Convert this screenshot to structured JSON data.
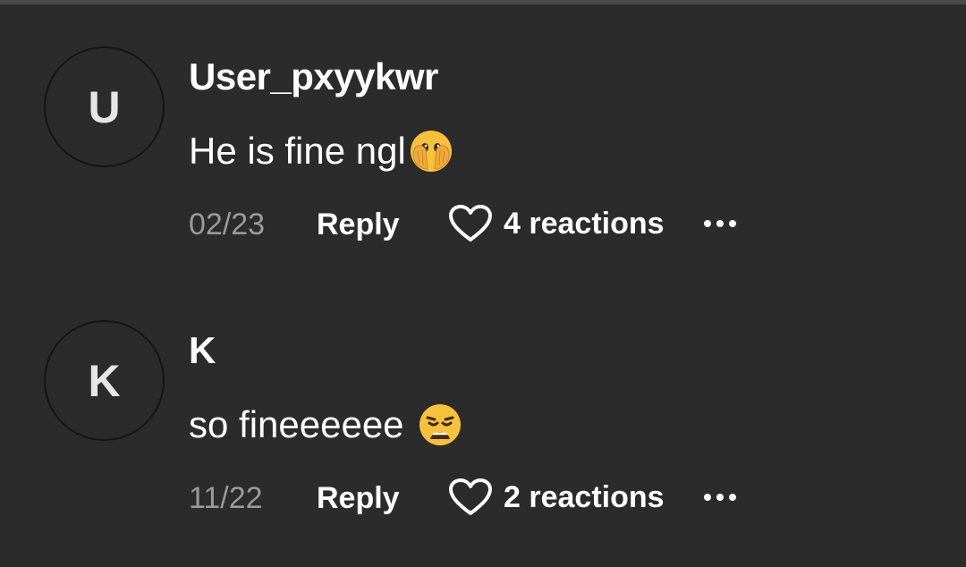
{
  "comments": [
    {
      "avatar_letter": "U",
      "author": "User_pxyykwr",
      "text": "He is fine ngl",
      "emoji_icon": "face-with-open-eyes-and-hand-over-mouth-icon",
      "date": "02/23",
      "reply_label": "Reply",
      "reactions_label": "4 reactions"
    },
    {
      "avatar_letter": "K",
      "author": "K",
      "text": "so fineeeeee",
      "emoji_icon": "weary-face-icon",
      "date": "11/22",
      "reply_label": "Reply",
      "reactions_label": "2 reactions"
    }
  ],
  "colors": {
    "background": "#2b2b2b",
    "primary_text": "#ffffff",
    "secondary_text": "#9a9a9a",
    "emoji_yellow": "#f7c23a"
  }
}
